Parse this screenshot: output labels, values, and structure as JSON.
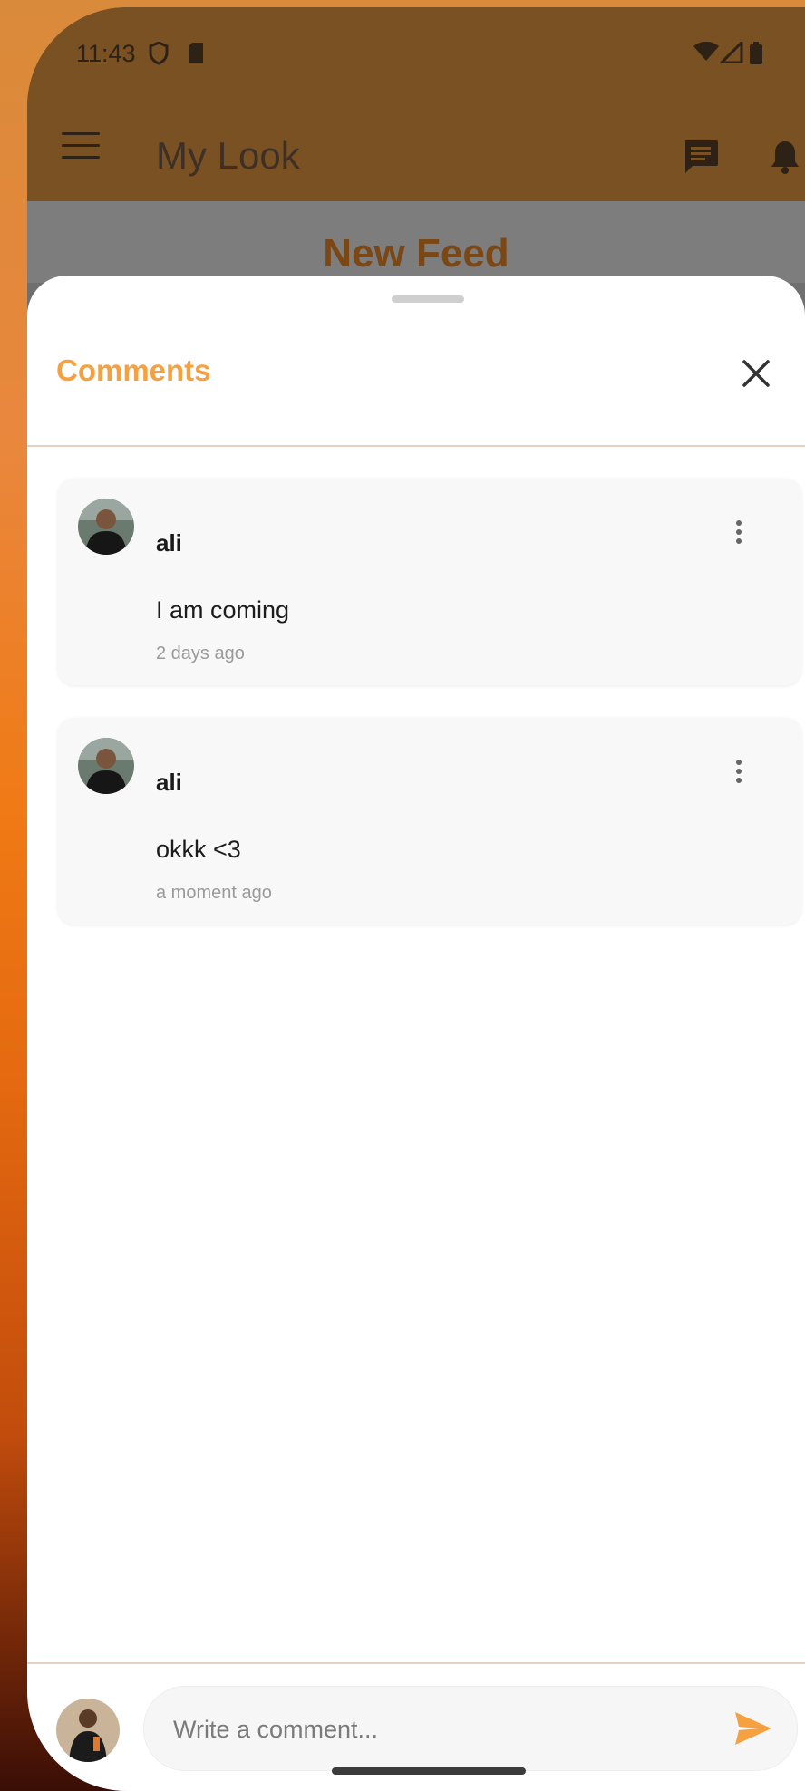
{
  "status_bar": {
    "time": "11:43",
    "icons": [
      "shield-icon",
      "sd-card-icon",
      "wifi-icon",
      "signal-icon",
      "battery-icon"
    ]
  },
  "app_bar": {
    "title": "My Look",
    "icons": [
      "menu-icon",
      "chat-icon",
      "bell-icon"
    ],
    "color": "#7a5123"
  },
  "feed": {
    "title": "New Feed"
  },
  "sheet": {
    "title": "Comments",
    "accent": "#f5a142",
    "comments": [
      {
        "user": "ali",
        "text": "I am coming",
        "time": "2 days ago"
      },
      {
        "user": "ali",
        "text": "okkk <3",
        "time": "a moment ago"
      }
    ],
    "input": {
      "placeholder": "Write a comment...",
      "value": ""
    },
    "send_color": "#f5a142"
  }
}
